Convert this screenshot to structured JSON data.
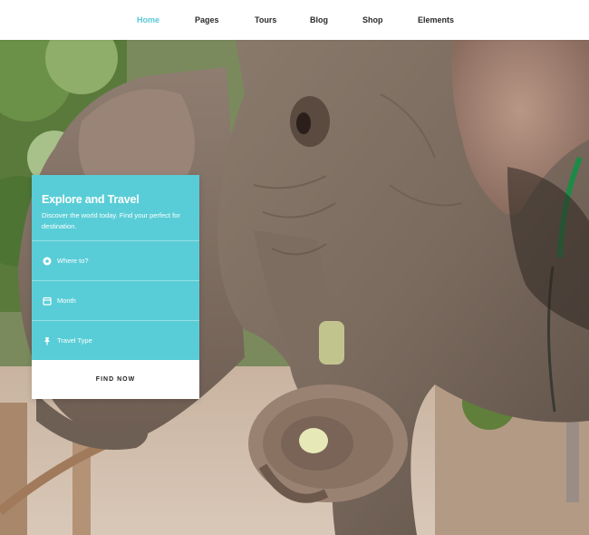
{
  "nav": {
    "items": [
      {
        "label": "Home",
        "active": true
      },
      {
        "label": "Pages",
        "active": false
      },
      {
        "label": "Tours",
        "active": false
      },
      {
        "label": "Blog",
        "active": false
      },
      {
        "label": "Shop",
        "active": false
      },
      {
        "label": "Elements",
        "active": false
      }
    ]
  },
  "search_card": {
    "title": "Explore and Travel",
    "subtitle": "Discover the world today. Find your perfect for destination.",
    "fields": [
      {
        "icon": "location-pin-icon",
        "placeholder": "Where to?"
      },
      {
        "icon": "calendar-icon",
        "placeholder": "Month"
      },
      {
        "icon": "pushpin-icon",
        "placeholder": "Travel Type"
      }
    ],
    "button_label": "FIND NOW"
  },
  "colors": {
    "accent": "#59cdd7",
    "nav_active": "#59c9d6"
  }
}
